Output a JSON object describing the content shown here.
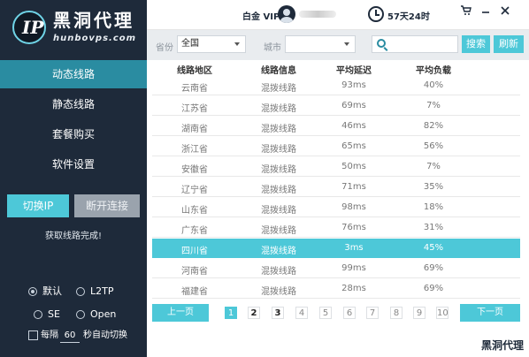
{
  "logo": {
    "mark": "IP",
    "title": "黑洞代理",
    "subtitle": "hunbovps.com"
  },
  "nav": [
    {
      "label": "动态线路",
      "active": true
    },
    {
      "label": "静态线路",
      "active": false
    },
    {
      "label": "套餐购买",
      "active": false
    },
    {
      "label": "软件设置",
      "active": false
    }
  ],
  "actions": {
    "switch_ip": "切换IP",
    "disconnect": "断开连接",
    "status": "获取线路完成!"
  },
  "protocol": {
    "default": "默认",
    "l2tp": "L2TP",
    "se": "SE",
    "open": "Open",
    "selected": "默认"
  },
  "auto_switch": {
    "prefix": "每隔",
    "interval": "60",
    "suffix": "秒自动切换"
  },
  "topbar": {
    "membership": "白金 VIP",
    "remaining": "57天24时"
  },
  "filter": {
    "province_label": "省份",
    "province_value": "全国",
    "city_label": "城市",
    "city_value": "",
    "search_placeholder": "",
    "search_button": "搜索",
    "refresh_button": "刷新"
  },
  "table": {
    "headers": [
      "线路地区",
      "线路信息",
      "平均延迟",
      "平均负载"
    ],
    "rows": [
      {
        "region": "云南省",
        "info": "混拨线路",
        "latency": "93ms",
        "load": "40%",
        "selected": false
      },
      {
        "region": "江苏省",
        "info": "混拨线路",
        "latency": "69ms",
        "load": "7%",
        "selected": false
      },
      {
        "region": "湖南省",
        "info": "混拨线路",
        "latency": "46ms",
        "load": "82%",
        "selected": false
      },
      {
        "region": "浙江省",
        "info": "混拨线路",
        "latency": "65ms",
        "load": "56%",
        "selected": false
      },
      {
        "region": "安徽省",
        "info": "混拨线路",
        "latency": "50ms",
        "load": "7%",
        "selected": false
      },
      {
        "region": "辽宁省",
        "info": "混拨线路",
        "latency": "71ms",
        "load": "35%",
        "selected": false
      },
      {
        "region": "山东省",
        "info": "混拨线路",
        "latency": "98ms",
        "load": "18%",
        "selected": false
      },
      {
        "region": "广东省",
        "info": "混拨线路",
        "latency": "76ms",
        "load": "31%",
        "selected": false
      },
      {
        "region": "四川省",
        "info": "混拨线路",
        "latency": "3ms",
        "load": "45%",
        "selected": true
      },
      {
        "region": "河南省",
        "info": "混拨线路",
        "latency": "99ms",
        "load": "69%",
        "selected": false
      },
      {
        "region": "福建省",
        "info": "混拨线路",
        "latency": "28ms",
        "load": "69%",
        "selected": false
      }
    ]
  },
  "pagination": {
    "prev": "上一页",
    "next": "下一页",
    "pages": [
      "1",
      "2",
      "3",
      "4",
      "5",
      "6",
      "7",
      "8",
      "9",
      "10"
    ],
    "current": "1"
  },
  "brand": "黑洞代理",
  "colors": {
    "sidebar": "#1e2a3a",
    "accent": "#4dc8d8",
    "nav_active": "#2a8ca1"
  }
}
